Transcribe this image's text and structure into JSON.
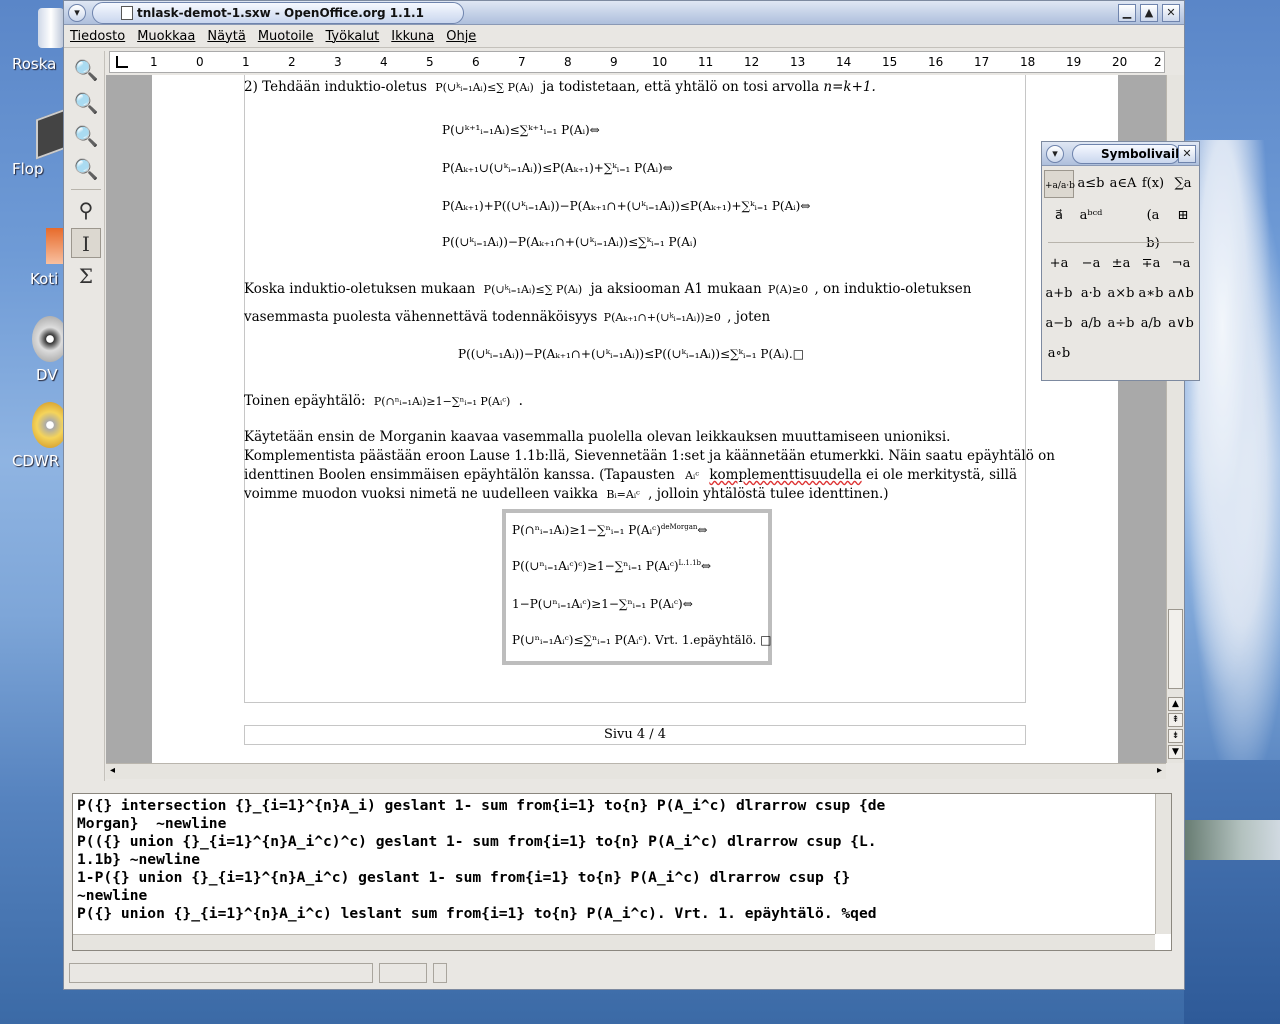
{
  "desktop": {
    "icons": [
      {
        "label": "Roska"
      },
      {
        "label": "Flop"
      },
      {
        "label": "Koti"
      },
      {
        "label": "DV"
      },
      {
        "label": "CDWR"
      }
    ]
  },
  "window": {
    "title": "tnlask-demot-1.sxw - OpenOffice.org 1.1.1",
    "controls": {
      "menu": "▾",
      "minimize": "▁",
      "maximize": "▲",
      "close": "✕"
    }
  },
  "menu": [
    "Tiedosto",
    "Muokkaa",
    "Näytä",
    "Muotoile",
    "Työkalut",
    "Ikkuna",
    "Ohje"
  ],
  "ruler": {
    "labels": [
      "1",
      "0",
      "1",
      "2",
      "3",
      "4",
      "5",
      "6",
      "7",
      "8",
      "9",
      "10",
      "11",
      "12",
      "13",
      "14",
      "15",
      "16",
      "17",
      "18",
      "19",
      "20",
      "2"
    ]
  },
  "document": {
    "para1_lead": "2) Tehdään induktio-oletus",
    "para1_mid": "ja todistetaan, että yhtälö on tosi arvolla",
    "para1_end": "n=k+1.",
    "eq1": "P(∪ᵏ⁺¹ᵢ₌₁Aᵢ)≤∑ᵏ⁺¹ᵢ₌₁ P(Aᵢ)⇔",
    "eq2": "P(Aₖ₊₁∪(∪ᵏᵢ₌₁Aᵢ))≤P(Aₖ₊₁)+∑ᵏᵢ₌₁ P(Aᵢ)⇔",
    "eq3": "P(Aₖ₊₁)+P((∪ᵏᵢ₌₁Aᵢ))−P(Aₖ₊₁∩+(∪ᵏᵢ₌₁Aᵢ))≤P(Aₖ₊₁)+∑ᵏᵢ₌₁ P(Aᵢ)⇔",
    "eq4": "P((∪ᵏᵢ₌₁Aᵢ))−P(Aₖ₊₁∩+(∪ᵏᵢ₌₁Aᵢ))≤∑ᵏᵢ₌₁ P(Aᵢ)",
    "para2_a": "Koska induktio-oletuksen mukaan",
    "para2_b": "ja aksiooman A1 mukaan",
    "para2_c": ", on induktio-oletuksen",
    "para2_d": "vasemmasta puolesta vähennettävä todennäköisyys",
    "para2_e": ", joten",
    "eq5": "P((∪ᵏᵢ₌₁Aᵢ))−P(Aₖ₊₁∩+(∪ᵏᵢ₌₁Aᵢ))≤P((∪ᵏᵢ₌₁Aᵢ))≤∑ᵏᵢ₌₁ P(Aᵢ).□",
    "para3_a": "Toinen epäyhtälö:",
    "para3_eq": "P(∩ⁿᵢ₌₁Aᵢ)≥1−∑ⁿᵢ₌₁ P(Aᵢᶜ)",
    "para3_b": ".",
    "para4_l1": "Käytetään ensin de Morganin kaavaa vasemmalla puolella olevan leikkauksen muuttamiseen unioniksi.",
    "para4_l2": "Komplementista päästään eroon Lause 1.1b:llä, Sievennetään 1:set ja käännetään etumerkki. Näin saatu epäyhtälö on",
    "para4_l3": "identtinen Boolen ensimmäisen epäyhtälön kanssa. (Tapausten",
    "para4_l3b": "komplementtisuudella",
    "para4_l3c": "ei ole merkitystä, sillä",
    "para4_l4": "voimme muodon vuoksi nimetä ne uudelleen vaikka",
    "para4_l4b": ", jolloin yhtälöstä tulee identtinen.)",
    "box_eq1": "P(∩ⁿᵢ₌₁Aᵢ)≥1−∑ⁿᵢ₌₁ P(Aᵢᶜ)",
    "box_eq1_sup": "deMorgan",
    "box_eq2": "P((∪ⁿᵢ₌₁Aᵢᶜ)ᶜ)≥1−∑ⁿᵢ₌₁ P(Aᵢᶜ)",
    "box_eq2_sup": "L.1.1b",
    "box_eq3": "1−P(∪ⁿᵢ₌₁Aᵢᶜ)≥1−∑ⁿᵢ₌₁ P(Aᵢᶜ)⇔",
    "box_eq4": "P(∪ⁿᵢ₌₁Aᵢᶜ)≤∑ⁿᵢ₌₁ P(Aᵢᶜ). Vrt. 1.epäyhtälö. □",
    "footer": "Sivu 4 / 4"
  },
  "formula_editor": {
    "lines": [
      "P({} intersection {}_{i=1}^{n}A_i) geslant 1- sum from{i=1} to{n} P(A_i^c) dlrarrow csup {de",
      "Morgan}  ~newline",
      "P(({} union {}_{i=1}^{n}A_i^c)^c) geslant 1- sum from{i=1} to{n} P(A_i^c) dlrarrow csup {L.",
      "1.1b} ~newline",
      "1-P({} union {}_{i=1}^{n}A_i^c) geslant 1- sum from{i=1} to{n} P(A_i^c) dlrarrow csup {}",
      "~newline",
      "P({} union {}_{i=1}^{n}A_i^c) leslant sum from{i=1} to{n} P(A_i^c). Vrt. 1. epäyhtälö. %qed"
    ]
  },
  "symbols_panel": {
    "title": "Symbolivaik",
    "categories": [
      "a≤b",
      "a∈A",
      "f(x)",
      "∑a"
    ],
    "categories2": [
      "a⃗",
      "aᵇᶜᵈ",
      "(a b)"
    ],
    "symbols": [
      [
        "+a",
        "−a",
        "±a",
        "∓a",
        "¬a"
      ],
      [
        "a+b",
        "a·b",
        "a×b",
        "a∗b",
        "a∧b"
      ],
      [
        "a−b",
        "a/b",
        "a÷b",
        "a/b",
        "a∨b"
      ],
      [
        "a∘b"
      ]
    ]
  }
}
